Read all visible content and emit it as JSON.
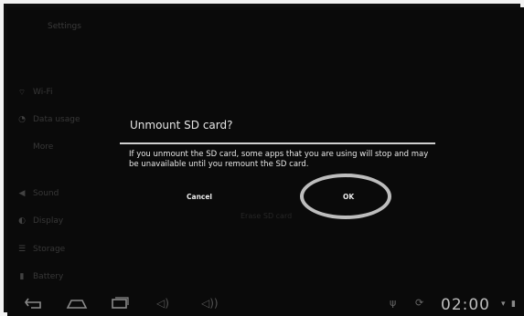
{
  "settings": {
    "title": "Settings",
    "items": [
      {
        "label": "Wi-Fi",
        "icon": "wifi-icon"
      },
      {
        "label": "Data usage",
        "icon": "data-usage-icon"
      },
      {
        "label": "More",
        "icon": ""
      },
      {
        "label": "Sound",
        "icon": "sound-icon"
      },
      {
        "label": "Display",
        "icon": "display-icon"
      },
      {
        "label": "Storage",
        "icon": "storage-icon"
      },
      {
        "label": "Battery",
        "icon": "battery-icon"
      }
    ],
    "background_button": "Erase SD card"
  },
  "dialog": {
    "title": "Unmount SD card?",
    "message": "If you unmount the SD card, some apps that you are using will stop and may be unavailable until you remount the SD card.",
    "cancel_label": "Cancel",
    "ok_label": "OK"
  },
  "status_bar": {
    "time": "02:00"
  }
}
